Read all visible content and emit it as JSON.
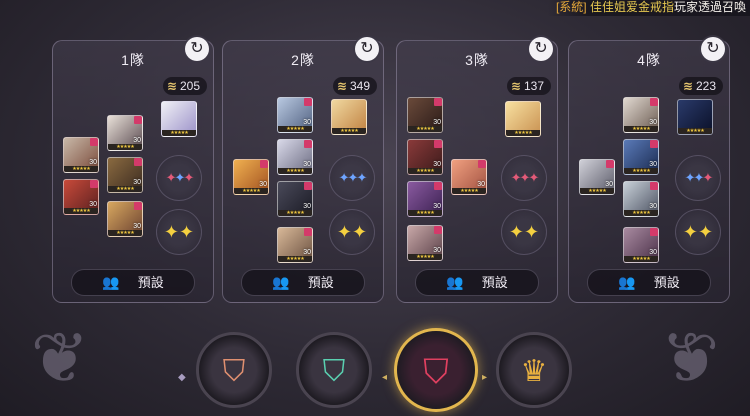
{
  "banner": {
    "tag": "[系統]",
    "player": "佳佳姐爱金戒指",
    "text": "玩家透過召喚"
  },
  "teams": [
    {
      "title": "1隊",
      "power": "205",
      "preset_label": "預設"
    },
    {
      "title": "2隊",
      "power": "349",
      "preset_label": "預設"
    },
    {
      "title": "3隊",
      "power": "137",
      "preset_label": "預設"
    },
    {
      "title": "4隊",
      "power": "223",
      "preset_label": "預設"
    }
  ],
  "portrait_level": "30",
  "icons": {
    "reset": "refresh-icon",
    "power": "combat-power-icon",
    "preset": "party-members-icon",
    "mode_1": "bronze-shield-emblem",
    "mode_2": "jade-shield-emblem",
    "mode_3": "crimson-shield-emblem",
    "mode_4": "gold-crown-emblem"
  },
  "colors": {
    "accent_gold": "#e8c870",
    "banner_tag": "#e6a93a",
    "banner_player": "#e6c850",
    "mode_selected_ring": "#e2b64e"
  }
}
